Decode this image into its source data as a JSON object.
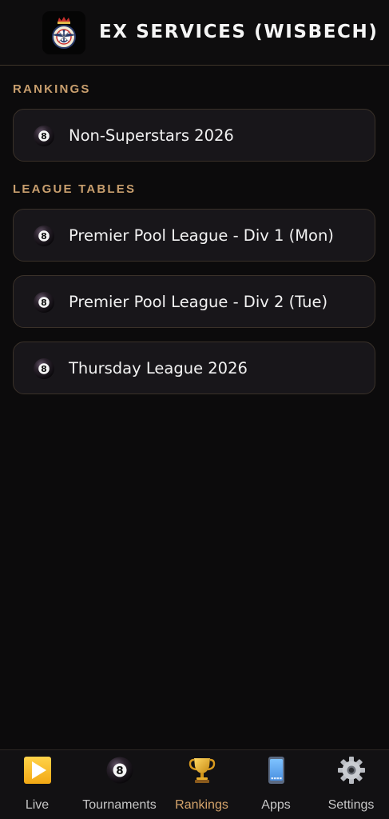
{
  "header": {
    "title": "EX SERVICES (WISBECH)",
    "logo_icon": "armed-forces-crest-icon"
  },
  "sections": {
    "rankings": {
      "label": "RANKINGS",
      "items": [
        {
          "label": "Non-Superstars 2026",
          "icon": "eight-ball-icon"
        }
      ]
    },
    "league_tables": {
      "label": "LEAGUE TABLES",
      "items": [
        {
          "label": "Premier Pool League - Div 1 (Mon)",
          "icon": "eight-ball-icon"
        },
        {
          "label": "Premier Pool League - Div 2 (Tue)",
          "icon": "eight-ball-icon"
        },
        {
          "label": "Thursday League 2026",
          "icon": "eight-ball-icon"
        }
      ]
    }
  },
  "bottom_nav": {
    "active": "Rankings",
    "items": [
      {
        "label": "Live",
        "icon": "play-icon"
      },
      {
        "label": "Tournaments",
        "icon": "eight-ball-icon"
      },
      {
        "label": "Rankings",
        "icon": "trophy-icon"
      },
      {
        "label": "Apps",
        "icon": "phone-icon"
      },
      {
        "label": "Settings",
        "icon": "gear-icon"
      }
    ]
  },
  "colors": {
    "background": "#0c0b0c",
    "accent": "#c99f6e",
    "card_background": "#18161a",
    "card_border": "#3a3129",
    "active_nav": "#d6a56c"
  }
}
